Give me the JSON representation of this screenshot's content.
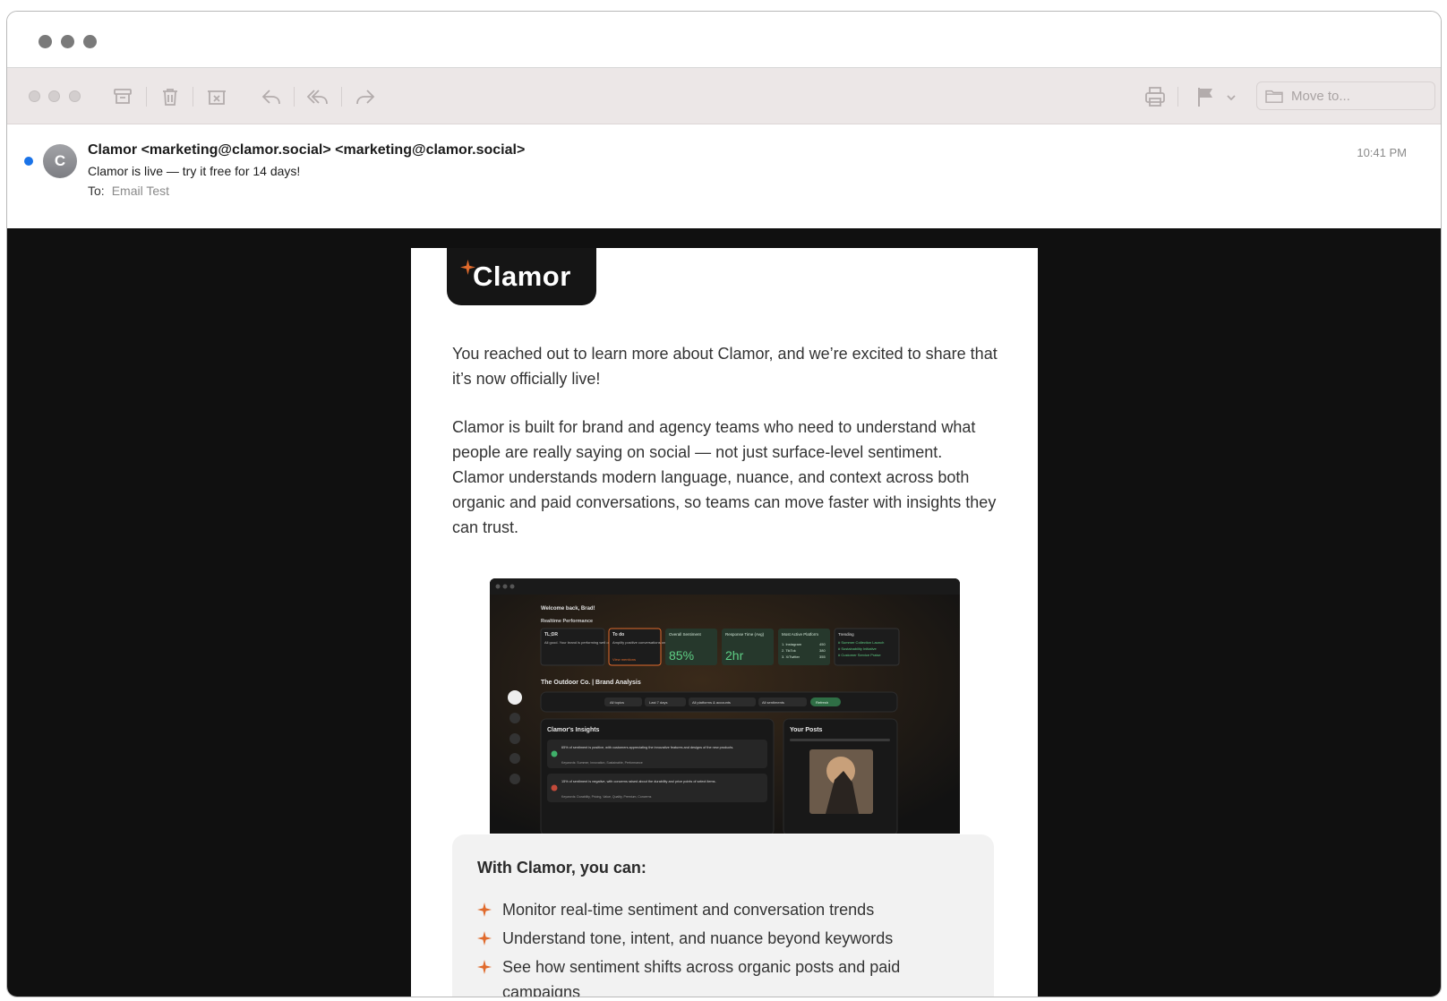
{
  "window": {
    "title_dots": [
      "close",
      "minimize",
      "zoom"
    ]
  },
  "toolbar": {
    "left_icons": [
      "archive-icon",
      "trash-icon",
      "junk-icon",
      "reply-icon",
      "reply-all-icon",
      "forward-icon"
    ],
    "right_icons": [
      "print-icon",
      "flag-icon",
      "chevron-down-icon",
      "folder-icon"
    ],
    "move_to_label": "Move to..."
  },
  "message": {
    "avatar_initial": "C",
    "from": "Clamor <marketing@clamor.social> <marketing@clamor.social>",
    "subject": "Clamor is live — try it free for 14 days!",
    "to_label": "To:",
    "to_value": "Email Test",
    "time": "10:41 PM"
  },
  "email": {
    "logo_text": "Clamor",
    "paragraph1": "You reached out to learn more about Clamor, and we’re excited to share that it’s now officially live!",
    "paragraph2": "Clamor is built for brand and agency teams who need to understand what people are really saying on social — not just surface-level sentiment. Clamor understands modern language, nuance, and context across both organic and paid conversations, so teams can move faster with insights they can trust.",
    "features_title": "With Clamor, you can:",
    "features": [
      "Monitor real-time sentiment and conversation trends",
      "Understand tone, intent, and nuance beyond keywords",
      "See how sentiment shifts across organic posts and paid campaigns"
    ]
  },
  "dashboard": {
    "welcome": "Welcome back, Brad!",
    "realtime_label": "Realtime Performance",
    "tldr_title": "TL;DR",
    "tldr_text": "All good. Your brand is performing well on all platforms.",
    "todo_title": "To do",
    "todo_text": "Amplify positive conversations on Instagram",
    "todo_link": "View mentions",
    "sentiment_label": "Overall Sentiment",
    "sentiment_value": "85%",
    "response_label": "Response Time (Avg)",
    "response_value": "2hr",
    "platform_label": "Most Active Platform",
    "platforms": [
      "1. Instagram",
      "2. TikTok",
      "3. X/Twitter"
    ],
    "platform_counts": [
      "450",
      "380",
      "355"
    ],
    "trending_label": "Trending",
    "trending_items": [
      "# Summer Collection Launch",
      "# Sustainability Initiative",
      "# Customer Service Praise"
    ],
    "brand_title": "The Outdoor Co. | Brand Analysis",
    "filters": [
      "All topics",
      "Last 7 days",
      "All platforms & accounts",
      "All sentiments"
    ],
    "refresh_label": "Refresh",
    "insights_title": "Clamor's Insights",
    "insight1": "65% of sentiment is positive, with customers appreciating the innovative features and designs of the new products.",
    "insight1_keywords": "Keywords: Summer, Innovation, Sustainable, Performance",
    "insight2": "15% of sentiment is negative, with concerns raised about the durability and price points of select items.",
    "insight2_keywords": "Keywords: Durability, Pricing, Value, Quality, Premium, Concerns",
    "posts_title": "Your Posts",
    "colors": {
      "accent": "#e06a2c",
      "positive": "#3fb06a",
      "negative": "#c24a3a"
    }
  }
}
